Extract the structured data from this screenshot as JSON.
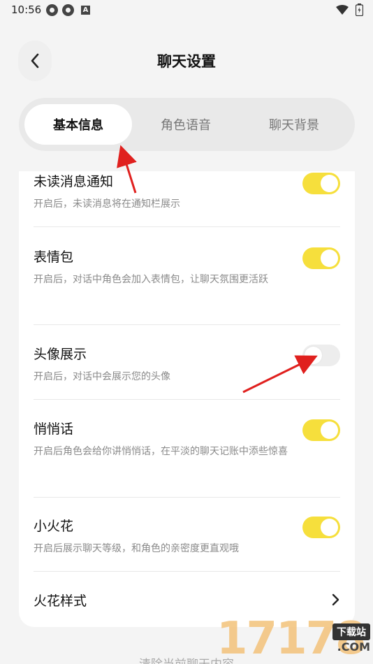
{
  "status_bar": {
    "time": "10:56"
  },
  "header": {
    "title": "聊天设置"
  },
  "tabs": [
    {
      "label": "基本信息",
      "active": true
    },
    {
      "label": "角色语音",
      "active": false
    },
    {
      "label": "聊天背景",
      "active": false
    }
  ],
  "settings": [
    {
      "title": "未读消息通知",
      "desc": "开启后，未读消息将在通知栏展示",
      "on": true
    },
    {
      "title": "表情包",
      "desc": "开启后，对话中角色会加入表情包，让聊天氛围更活跃",
      "on": true
    },
    {
      "title": "头像展示",
      "desc": "开启后，对话中会展示您的头像",
      "on": false
    },
    {
      "title": "悄悄话",
      "desc": "开启后角色会给你讲悄悄话，在平淡的聊天记账中添些惊喜",
      "on": true
    },
    {
      "title": "小火花",
      "desc": "开启后展示聊天等级，和角色的亲密度更直观哦",
      "on": true
    }
  ],
  "spark_style": {
    "label": "火花样式"
  },
  "bottom_link": "清除当前聊天内容",
  "watermark": {
    "digits": "17178",
    "badge": "下载站",
    "suffix": ".COM"
  },
  "colors": {
    "accent": "#f6df3c",
    "annotation_arrow": "#e0201e"
  }
}
